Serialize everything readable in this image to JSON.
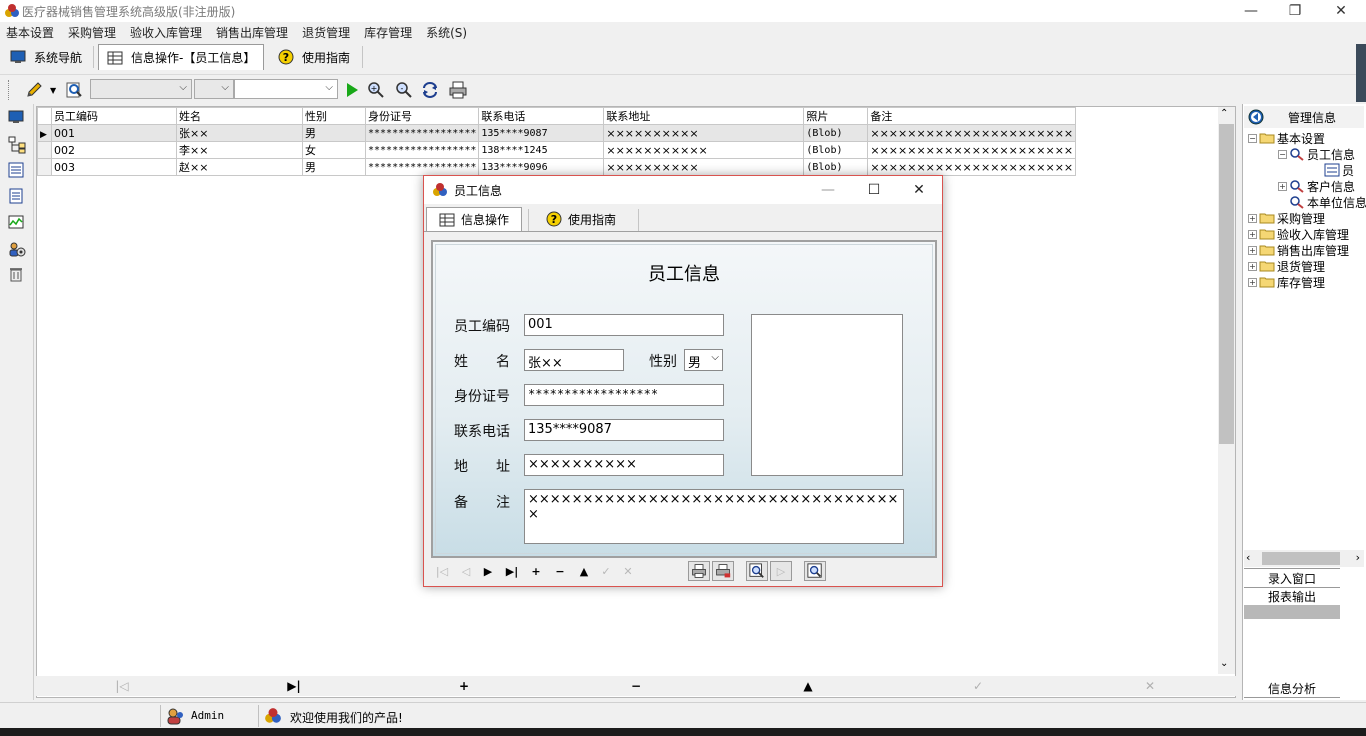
{
  "window": {
    "title": "医疗器械销售管理系统高级版(非注册版)",
    "min_glyph": "—",
    "restore_glyph": "❐",
    "close_glyph": "✕"
  },
  "menu": [
    "基本设置",
    "采购管理",
    "验收入库管理",
    "销售出库管理",
    "退货管理",
    "库存管理",
    "系统(S)"
  ],
  "nav_tabs": {
    "nav": "系统导航",
    "info": "信息操作-【员工信息】",
    "guide": "使用指南"
  },
  "grid": {
    "columns": [
      "员工编码",
      "姓名",
      "性别",
      "身份证号",
      "联系电话",
      "联系地址",
      "照片",
      "备注"
    ],
    "rows": [
      [
        "001",
        "张××",
        "男",
        "******************",
        "135****9087",
        "××××××××××",
        "(Blob)",
        "××××××××××××××××××××××"
      ],
      [
        "002",
        "李××",
        "女",
        "******************",
        "138****1245",
        "×××××××××××",
        "(Blob)",
        "××××××××××××××××××××××"
      ],
      [
        "003",
        "赵××",
        "男",
        "******************",
        "133****9096",
        "××××××××××",
        "(Blob)",
        "××××××××××××××××××××××"
      ]
    ]
  },
  "right_panel": {
    "header": "管理信息",
    "tree": [
      {
        "label": "基本设置",
        "level": 0,
        "expander": "−"
      },
      {
        "label": "员工信息",
        "level": 1,
        "expander": "−"
      },
      {
        "label": "员",
        "level": 2,
        "expander": ""
      },
      {
        "label": "客户信息",
        "level": 1,
        "expander": "+"
      },
      {
        "label": "本单位信息",
        "level": 1,
        "expander": ""
      },
      {
        "label": "采购管理",
        "level": 0,
        "expander": "+"
      },
      {
        "label": "验收入库管理",
        "level": 0,
        "expander": "+"
      },
      {
        "label": "销售出库管理",
        "level": 0,
        "expander": "+"
      },
      {
        "label": "退货管理",
        "level": 0,
        "expander": "+"
      },
      {
        "label": "库存管理",
        "level": 0,
        "expander": "+"
      }
    ],
    "entry_window": "录入窗口",
    "report_output": "报表输出",
    "info_analysis": "信息分析"
  },
  "status": {
    "user": "Admin",
    "message": "欢迎使用我们的产品!"
  },
  "dialog": {
    "title": "员工信息",
    "tabs": [
      "信息操作",
      "使用指南"
    ],
    "form_title": "员工信息",
    "labels": {
      "code": "员工编码",
      "name": "姓　　名",
      "gender": "性别",
      "id_no": "身份证号",
      "phone": "联系电话",
      "address": "地　　址",
      "remark": "备　　注"
    },
    "values": {
      "code": "001",
      "name": "张××",
      "gender": "男",
      "id_no": "******************",
      "phone": "135****9087",
      "address": "××××××××××",
      "remark": "×××××××××××××××××××××××××××××××××××"
    }
  }
}
